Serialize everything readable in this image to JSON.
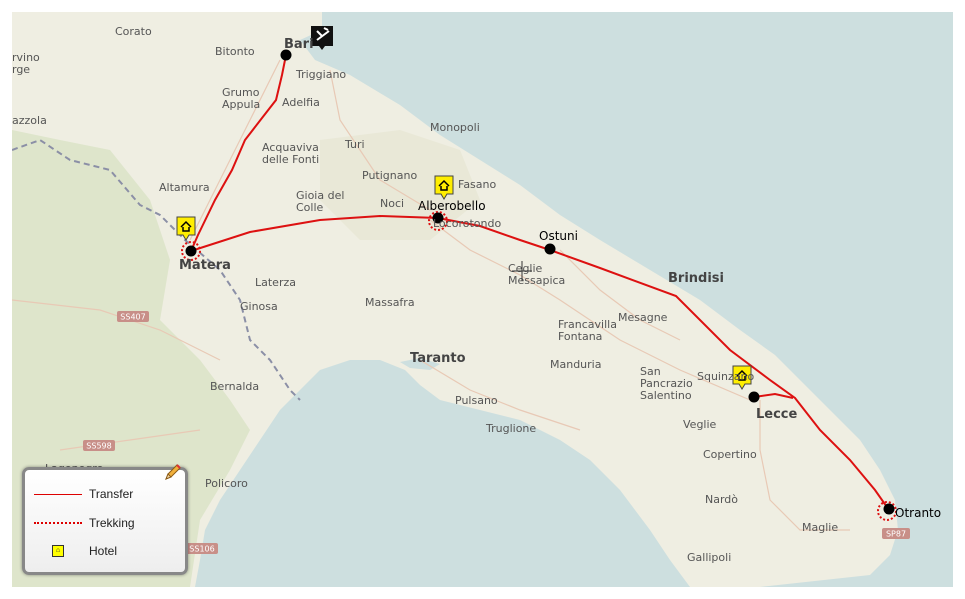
{
  "map": {
    "places": {
      "corato": "Corato",
      "bitonto": "Bitonto",
      "triggiano": "Triggiano",
      "grumo": "Grumo\nAppula",
      "adelfia": "Adelfia",
      "acquaviva": "Acquaviva\ndelle Fonti",
      "turi": "Turi",
      "monopoli": "Monopoli",
      "putignano": "Putignano",
      "fasano": "Fasano",
      "altamura": "Altamura",
      "gioia": "Gioia del\nColle",
      "noci": "Noci",
      "locorotondo": "Locorotondo",
      "ceglie": "Ceglie\nMessapica",
      "laterza": "Laterza",
      "ginosa": "Ginosa",
      "massafra": "Massafra",
      "taranto": "Taranto",
      "francavilla": "Francavilla\nFontana",
      "mesagne": "Mesagne",
      "brindisi": "Brindisi",
      "bernalda": "Bernalda",
      "pulsano": "Pulsano",
      "manduria": "Manduria",
      "sanpancrazio": "San\nPancrazio\nSalentino",
      "squinzano": "Squinzano",
      "veglie": "Veglie",
      "truglione": "Truglione",
      "copertino": "Copertino",
      "policoro": "Policoro",
      "lagonegro": "Lagonegro",
      "nardo": "Nardò",
      "maglie": "Maglie",
      "gallipoli": "Gallipoli",
      "gravina": "rvino\nrge",
      "azzola": "azzola"
    },
    "stops": {
      "bari": "Bari",
      "matera": "Matera",
      "alberobello": "Alberobello",
      "ostuni": "Ostuni",
      "lecce": "Lecce",
      "otranto": "Otranto"
    },
    "roads": {
      "ss407": "SS407",
      "ss598": "SS598",
      "ss106": "SS106",
      "sp87": "SP87"
    },
    "colors": {
      "route": "#dd1111",
      "land": "#efeee2",
      "sea": "#cddfdf",
      "hotel": "#ffee00"
    },
    "icons": [
      "airport-icon",
      "hotel-icon",
      "pencil-icon",
      "crosshair-icon"
    ]
  },
  "legend": {
    "transfer": "Transfer",
    "trekking": "Trekking",
    "hotel": "Hotel"
  }
}
